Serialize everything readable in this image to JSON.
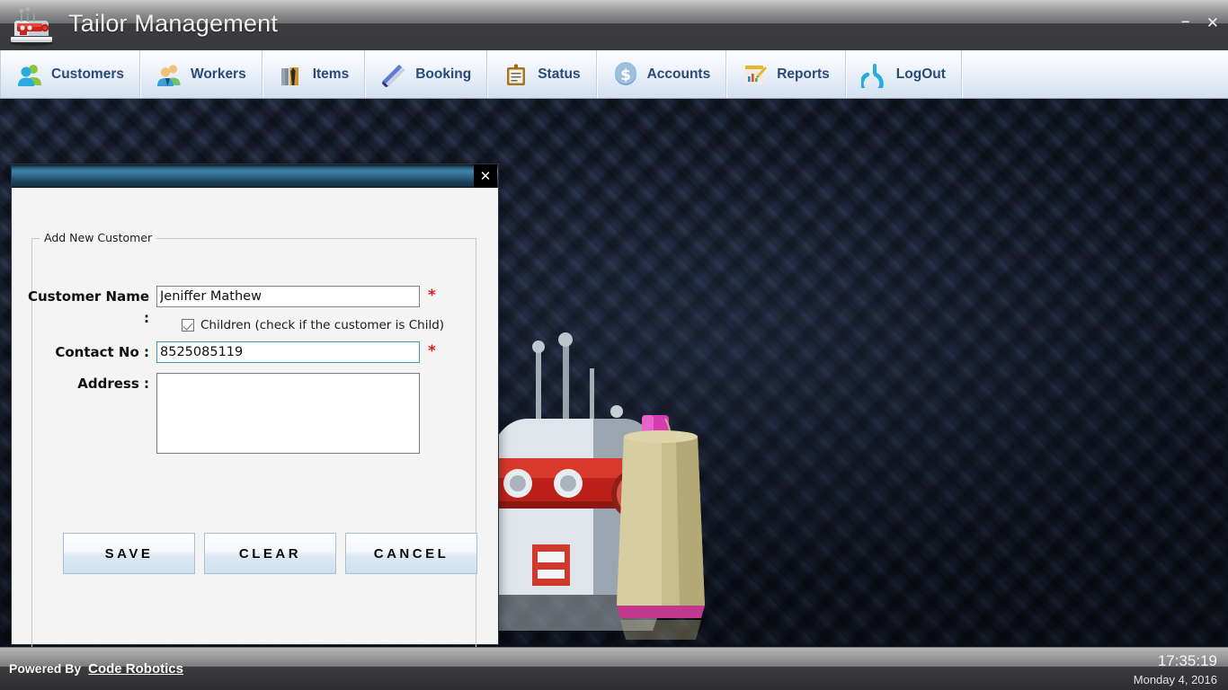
{
  "window": {
    "title": "Tailor Management",
    "logo_icon": "sewing-machine-icon",
    "minimize_label": "–",
    "close_label": "✕"
  },
  "menubar": {
    "items": [
      {
        "label": "Customers",
        "icon": "customers-people-icon"
      },
      {
        "label": "Workers",
        "icon": "workers-people-icon"
      },
      {
        "label": "Items",
        "icon": "suit-items-icon"
      },
      {
        "label": "Booking",
        "icon": "book-booking-icon"
      },
      {
        "label": "Status",
        "icon": "clipboard-status-icon"
      },
      {
        "label": "Accounts",
        "icon": "dollar-accounts-icon"
      },
      {
        "label": "Reports",
        "icon": "chart-pencil-reports-icon"
      },
      {
        "label": "LogOut",
        "icon": "power-logout-icon"
      }
    ]
  },
  "desktop": {
    "background_icons": [
      "sewing-machine-image",
      "thread-spool-image"
    ],
    "pattern_color": "#222c40"
  },
  "dialog": {
    "close_label": "✕",
    "group_legend": "Add New Customer",
    "fields": {
      "customer_name": {
        "label": "Customer Name :",
        "value": "Jeniffer Mathew",
        "placeholder": "",
        "required_marker": "*",
        "focused": false
      },
      "contact_no": {
        "label": "Contact No :",
        "value": "8525085119",
        "placeholder": "",
        "required_marker": "*",
        "focused": true
      },
      "address": {
        "label": "Address :",
        "value": "",
        "placeholder": "",
        "required_marker": "",
        "focused": false
      }
    },
    "checkbox": {
      "label": "Children (check if the customer is Child)",
      "checked": true
    },
    "buttons": {
      "save": "SAVE",
      "clear": "CLEAR",
      "cancel": "CANCEL"
    }
  },
  "footer": {
    "powered_by": "Powered By",
    "brand": "Code Robotics",
    "time": "17:35:19",
    "date": "Monday 4, 2016"
  },
  "colors": {
    "accent_blue": "#2a4a77",
    "required_red": "#e01b1b",
    "focus_border": "#3d97c9",
    "dialog_title": "#2e6285"
  }
}
